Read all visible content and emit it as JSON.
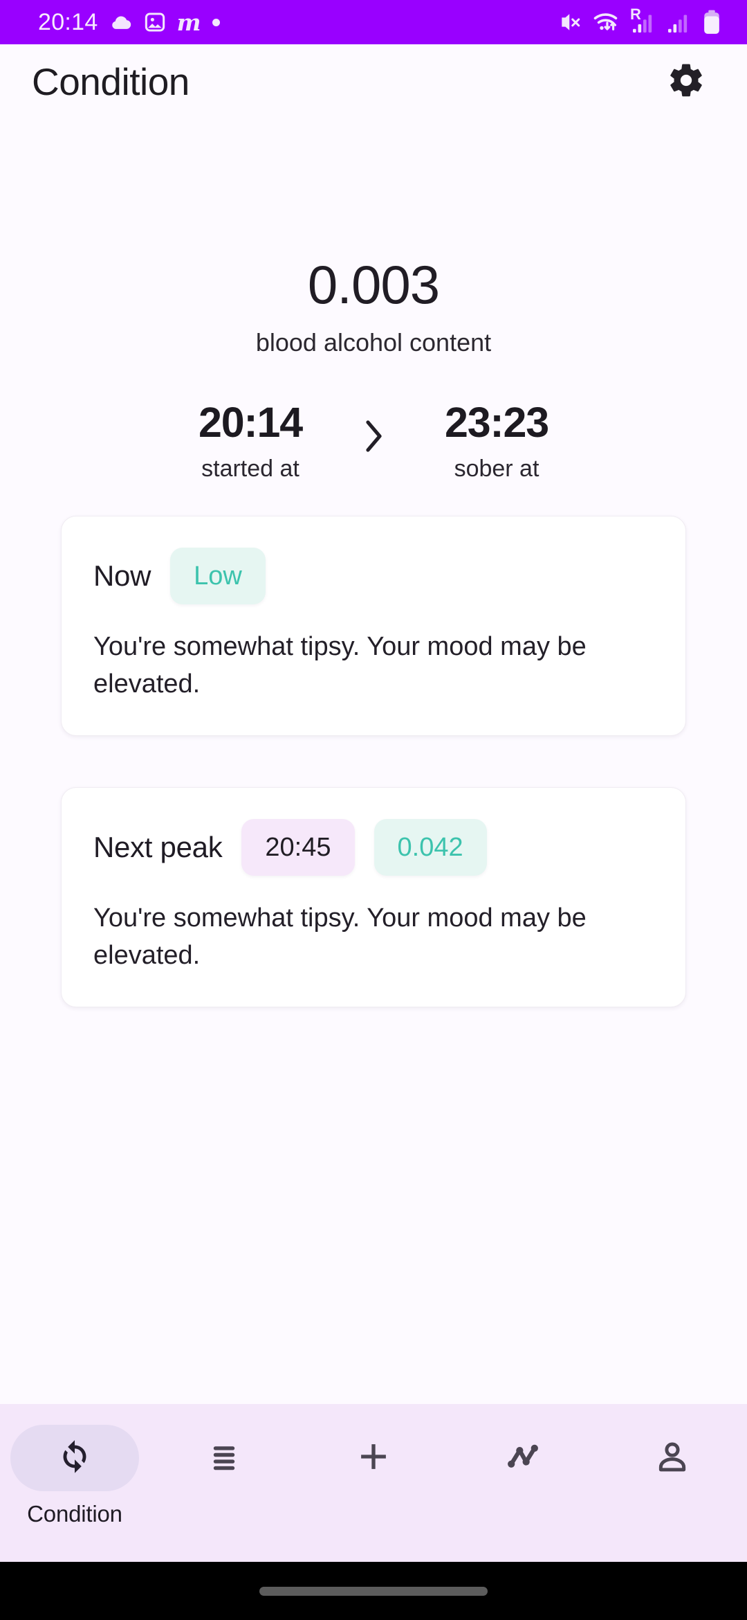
{
  "status_bar": {
    "clock": "20:14",
    "bg_color": "#9900ff",
    "left_icons": [
      "cloud-icon",
      "photo-icon",
      "m-logo-icon",
      "dot-icon"
    ],
    "m_logo_text": "m",
    "right_icons": [
      "mute-icon",
      "wifi-icon",
      "roaming-signal-icon",
      "signal-icon",
      "battery-icon"
    ],
    "roaming_label": "R"
  },
  "app_bar": {
    "title": "Condition",
    "settings_icon": "gear-icon"
  },
  "bac": {
    "value": "0.003",
    "label": "blood alcohol content"
  },
  "timeline": {
    "start_time": "20:14",
    "start_caption": "started at",
    "arrow_icon": "chevron-right-icon",
    "sober_time": "23:23",
    "sober_caption": "sober at"
  },
  "cards": [
    {
      "title": "Now",
      "badges": [
        {
          "text": "Low",
          "style": "mint"
        }
      ],
      "body": "You're somewhat tipsy. Your mood may be elevated."
    },
    {
      "title": "Next peak",
      "badges": [
        {
          "text": "20:45",
          "style": "lavender"
        },
        {
          "text": "0.042",
          "style": "mint"
        }
      ],
      "body": "You're somewhat tipsy. Your mood may be elevated."
    }
  ],
  "bottom_nav": {
    "bg_color": "#f4e7fa",
    "items": [
      {
        "label": "Condition",
        "icon": "sync-icon",
        "active": true
      },
      {
        "label": "",
        "icon": "list-icon",
        "active": false
      },
      {
        "label": "",
        "icon": "plus-icon",
        "active": false
      },
      {
        "label": "",
        "icon": "line-chart-icon",
        "active": false
      },
      {
        "label": "",
        "icon": "person-icon",
        "active": false
      }
    ]
  },
  "colors": {
    "accent_purple": "#9900ff",
    "mint_badge_bg": "#e6f6f2",
    "mint_badge_text": "#3cc3ad",
    "lavender_badge_bg": "#f6e8fa",
    "page_bg": "#fdfaff",
    "nav_bg": "#f4e7fa"
  }
}
